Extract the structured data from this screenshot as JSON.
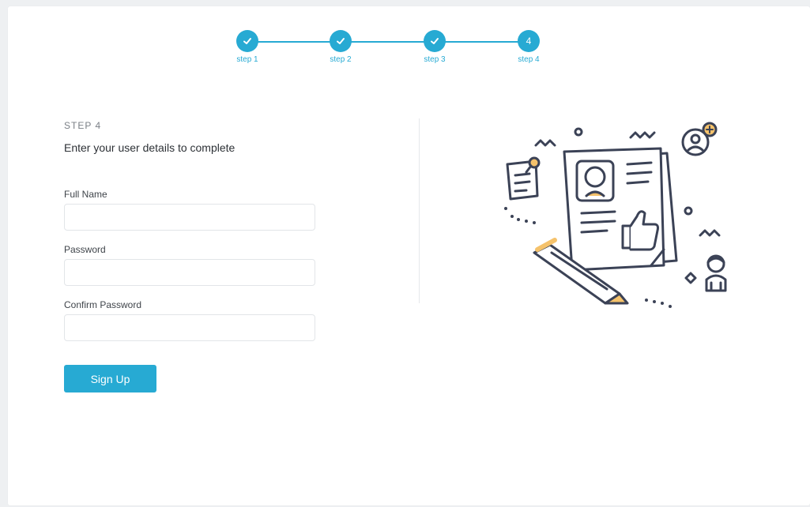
{
  "stepper": {
    "steps": [
      {
        "label": "step 1",
        "number": "1",
        "status": "complete"
      },
      {
        "label": "step 2",
        "number": "2",
        "status": "complete"
      },
      {
        "label": "step 3",
        "number": "3",
        "status": "complete"
      },
      {
        "label": "step 4",
        "number": "4",
        "status": "current"
      }
    ]
  },
  "form": {
    "step_title": "STEP 4",
    "subtitle": "Enter your user details to complete",
    "fields": [
      {
        "label": "Full Name",
        "value": "",
        "placeholder": ""
      },
      {
        "label": "Password",
        "value": "",
        "placeholder": ""
      },
      {
        "label": "Confirm Password",
        "value": "",
        "placeholder": ""
      }
    ],
    "submit_label": "Sign Up"
  },
  "illustration": {
    "icon": "resume-approval-illustration"
  },
  "colors": {
    "accent": "#27aad3",
    "line_art": "#3b4256",
    "highlight": "#f5c26b"
  }
}
